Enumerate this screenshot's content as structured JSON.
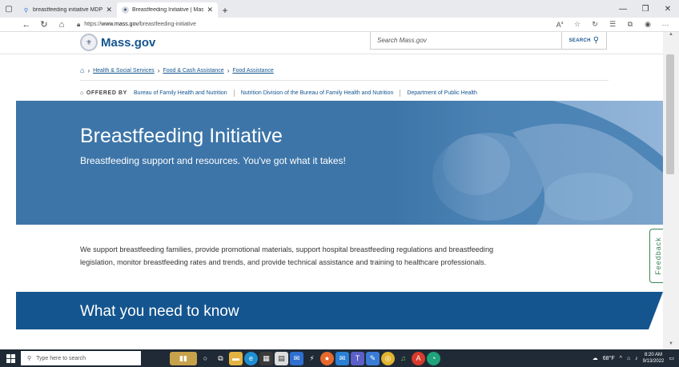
{
  "browser": {
    "tabs": [
      {
        "label": "breastfeeding initiative MDPH",
        "active": false,
        "favicon": "search-icon"
      },
      {
        "label": "Breastfeeding Initiative | Mass.go",
        "active": true,
        "favicon": "mass-seal-icon"
      }
    ],
    "address": {
      "scheme": "https://",
      "host": "www.mass.gov",
      "path": "/breastfeeding-initiative"
    }
  },
  "site": {
    "logo_text": "Mass.gov",
    "search_placeholder": "Search Mass.gov",
    "search_button": "SEARCH",
    "brand_color": "#14558f",
    "hero_color": "#3d75a8"
  },
  "breadcrumb": [
    "Health & Social Services",
    "Food & Cash Assistance",
    "Food Assistance"
  ],
  "offered_by": {
    "label": "OFFERED BY",
    "orgs": [
      "Bureau of Family Health and Nutrition",
      "Nutrition Division of the Bureau of Family Health and Nutrition",
      "Department of Public Health"
    ]
  },
  "hero": {
    "title": "Breastfeeding Initiative",
    "subtitle": "Breastfeeding support and resources. You've got what it takes!"
  },
  "intro": "We support breastfeeding families, provide promotional materials, support hospital breastfeeding regulations and breastfeeding legislation, monitor breastfeeding rates and trends, and provide technical assistance and training to healthcare professionals.",
  "section_title": "What you need to know",
  "feedback_label": "Feedback",
  "taskbar": {
    "search_placeholder": "Type here to search",
    "weather": "68°F",
    "time": "8:20 AM",
    "date": "9/13/2022"
  }
}
